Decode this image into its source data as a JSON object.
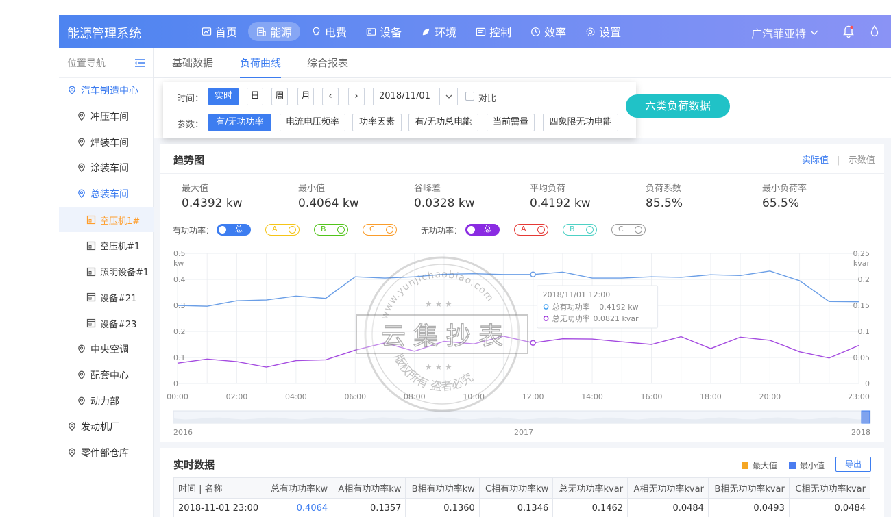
{
  "header": {
    "brand": "能源管理系统",
    "nav": [
      {
        "label": "首页",
        "icon": "chart-line-icon"
      },
      {
        "label": "能源",
        "icon": "database-icon",
        "active": true
      },
      {
        "label": "电费",
        "icon": "lightbulb-icon"
      },
      {
        "label": "设备",
        "icon": "device-icon"
      },
      {
        "label": "环境",
        "icon": "leaf-icon"
      },
      {
        "label": "控制",
        "icon": "panel-icon"
      },
      {
        "label": "效率",
        "icon": "clock-icon"
      },
      {
        "label": "设置",
        "icon": "gear-icon"
      }
    ],
    "company": "广汽菲亚特"
  },
  "sidebar": {
    "title": "位置导航",
    "items": [
      {
        "label": "汽车制造中心",
        "level": 0,
        "style": "blue"
      },
      {
        "label": "冲压车间",
        "level": 1
      },
      {
        "label": "焊装车间",
        "level": 1
      },
      {
        "label": "涂装车间",
        "level": 1
      },
      {
        "label": "总装车间",
        "level": 1,
        "style": "blue"
      },
      {
        "label": "空压机1#",
        "level": 2,
        "style": "selected"
      },
      {
        "label": "空压机#1",
        "level": 2
      },
      {
        "label": "照明设备#1",
        "level": 2
      },
      {
        "label": "设备#21",
        "level": 2
      },
      {
        "label": "设备#23",
        "level": 2
      },
      {
        "label": "中央空调",
        "level": 1
      },
      {
        "label": "配套中心",
        "level": 1
      },
      {
        "label": "动力部",
        "level": 1
      },
      {
        "label": "发动机厂",
        "level": 0
      },
      {
        "label": "零件部仓库",
        "level": 0
      }
    ]
  },
  "tabs": [
    "基础数据",
    "负荷曲线",
    "综合报表"
  ],
  "filter": {
    "time_label": "时间：",
    "time_buttons": [
      "实时",
      "日",
      "周",
      "月"
    ],
    "prev": "‹",
    "next": "›",
    "date": "2018/11/01",
    "compare": "对比",
    "param_label": "参数：",
    "params": [
      "有/无功功率",
      "电流电压频率",
      "功率因素",
      "有/无功总电能",
      "当前需量",
      "四象限无功电能"
    ]
  },
  "badge": "六类负荷数据",
  "trend": {
    "title": "趋势图",
    "actual": "实际值",
    "sep": "|",
    "display": "示数值",
    "stats": [
      {
        "label": "最大值",
        "value": "0.4392 kw"
      },
      {
        "label": "最小值",
        "value": "0.4064 kw"
      },
      {
        "label": "谷峰差",
        "value": "0.0328 kw"
      },
      {
        "label": "平均负荷",
        "value": "0.4192 kw"
      },
      {
        "label": "负荷系数",
        "value": "85.5%"
      },
      {
        "label": "最小负荷率",
        "value": "65.5%"
      }
    ],
    "active_label": "有功功率：",
    "reactive_label": "无功功率：",
    "active_toggles": [
      {
        "label": "总",
        "color": "#3d7df0",
        "on": true
      },
      {
        "label": "A",
        "color": "#f5c518"
      },
      {
        "label": "B",
        "color": "#52c41a"
      },
      {
        "label": "C",
        "color": "#fa9d2b"
      }
    ],
    "reactive_toggles": [
      {
        "label": "总",
        "color": "#8a2be2",
        "on": true
      },
      {
        "label": "A",
        "color": "#e53935"
      },
      {
        "label": "B",
        "color": "#4fd1c5"
      },
      {
        "label": "C",
        "color": "#999999"
      }
    ],
    "tooltip": {
      "time": "2018/11/01 12:00",
      "rows": [
        {
          "name": "总有功功率",
          "value": "0.4192 kw",
          "color": "#3d9df0"
        },
        {
          "name": "总无功功率",
          "value": "0.0821 kvar",
          "color": "#9b30d9"
        }
      ]
    },
    "slider_labels": [
      "2016",
      "2017",
      "2018"
    ]
  },
  "chart_data": {
    "type": "line",
    "x": [
      "00:00",
      "01:00",
      "02:00",
      "03:00",
      "04:00",
      "05:00",
      "06:00",
      "07:00",
      "08:00",
      "09:00",
      "10:00",
      "11:00",
      "12:00",
      "13:00",
      "14:00",
      "15:00",
      "16:00",
      "17:00",
      "18:00",
      "19:00",
      "20:00",
      "21:00",
      "22:00",
      "23:00"
    ],
    "xticks": [
      "00:00",
      "02:00",
      "04:00",
      "06:00",
      "08:00",
      "10:00",
      "12:00",
      "14:00",
      "16:00",
      "18:00",
      "20:00",
      "23:00"
    ],
    "ylabel": "kw",
    "y2label": "kvar",
    "ylim": [
      0,
      0.5
    ],
    "y2lim": [
      0,
      0.25
    ],
    "yticks": [
      "0.5",
      "0.4",
      "0.3",
      "0.2",
      "0.1",
      "0"
    ],
    "y2ticks": [
      "0.25",
      "0.2",
      "0.15",
      "0.1",
      "0.05",
      "0"
    ],
    "grid": true,
    "series": [
      {
        "name": "总有功功率",
        "axis": "left",
        "color": "#6a9ee6",
        "values": [
          0.3,
          0.297,
          0.318,
          0.321,
          0.336,
          0.327,
          0.41,
          0.405,
          0.41,
          0.42,
          0.422,
          0.419,
          0.419,
          0.428,
          0.405,
          0.405,
          0.41,
          0.408,
          0.418,
          0.415,
          0.432,
          0.395,
          0.315,
          0.314
        ]
      },
      {
        "name": "总无功功率",
        "axis": "right",
        "color": "#a44be0",
        "values": [
          0.039,
          0.047,
          0.042,
          0.0315,
          0.044,
          0.0455,
          0.064,
          0.078,
          0.062,
          0.081,
          0.076,
          0.091,
          0.078,
          0.086,
          0.0855,
          0.08,
          0.075,
          0.09,
          0.067,
          0.089,
          0.083,
          0.061,
          0.049,
          0.073
        ]
      }
    ]
  },
  "realtime": {
    "title": "实时数据",
    "legend_max": "最大值",
    "legend_min": "最小值",
    "export": "导出",
    "columns": [
      "时间 | 名称",
      "总有功功率kw",
      "A相有功功率kw",
      "B相有功功率kw",
      "C相有功功率kw",
      "总无功功率kvar",
      "A相无功功率kvar",
      "B相无功功率kvar",
      "C相无功功率kvar"
    ],
    "rows": [
      [
        "2018-11-01 23:00",
        "0.4064",
        "0.1357",
        "0.1360",
        "0.1346",
        "0.1462",
        "0.0484",
        "0.0493",
        "0.0484"
      ]
    ]
  },
  "colors": {
    "accent": "#3d7df0",
    "badge": "#20c2c7",
    "max": "#f5a623",
    "min": "#4a7cf0"
  },
  "watermark": {
    "top": "www.yunjichaobiao.com",
    "main": "云 集 抄 表",
    "bottom": "版权所有  盗者必究"
  }
}
